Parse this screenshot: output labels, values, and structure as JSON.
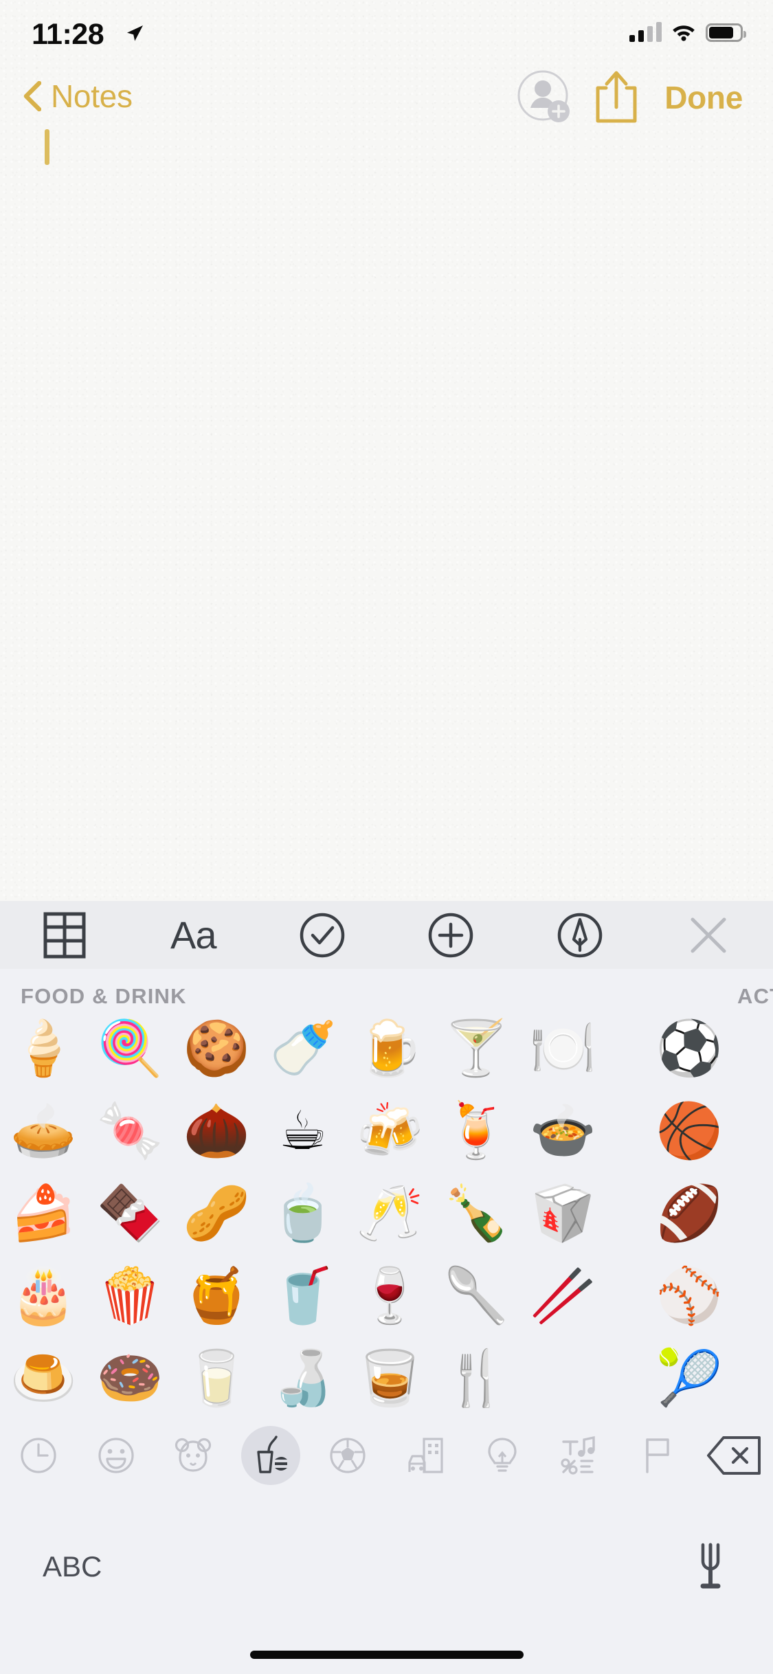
{
  "status_bar": {
    "time": "11:28",
    "location_icon": "location-arrow-icon",
    "cellular_icon": "cellular-signal-icon",
    "wifi_icon": "wifi-icon",
    "battery_icon": "battery-icon",
    "signal_bars_filled": 2,
    "signal_bars_total": 4,
    "battery_level_pct": 72
  },
  "nav_bar": {
    "back_label": "Notes",
    "back_icon": "chevron-left-icon",
    "add_person_icon": "add-person-icon",
    "share_icon": "share-icon",
    "done_label": "Done",
    "accent_color": "#d8b14a",
    "disabled_color": "#c9c9cd"
  },
  "note": {
    "text": "",
    "caret_color": "#dcbc5e"
  },
  "format_toolbar": {
    "background": "#ebecef",
    "items": [
      {
        "name": "table-icon",
        "label": "Table"
      },
      {
        "name": "text-format-icon",
        "label": "Aa"
      },
      {
        "name": "checklist-icon",
        "label": "Checklist"
      },
      {
        "name": "add-attachment-icon",
        "label": "Add"
      },
      {
        "name": "markup-pen-icon",
        "label": "Markup"
      },
      {
        "name": "close-icon",
        "label": "Close"
      }
    ]
  },
  "keyboard": {
    "background": "#f0f1f5",
    "category_headers": {
      "current": "FOOD & DRINK",
      "next": "ACTIVITY"
    },
    "emoji_rows": [
      [
        "🍦",
        "🍭",
        "🍪",
        "🍼",
        "🍺",
        "🍸",
        "🍽️",
        "⚽"
      ],
      [
        "🥧",
        "🍬",
        "🌰",
        "☕",
        "🍻",
        "🍹",
        "🍲",
        "🏀"
      ],
      [
        "🍰",
        "🍫",
        "🥜",
        "🍵",
        "🥂",
        "🍾",
        "🥡",
        "🏈"
      ],
      [
        "🎂",
        "🍿",
        "🍯",
        "🥤",
        "🍷",
        "🥄",
        "🥢",
        "⚾"
      ],
      [
        "🍮",
        "🍩",
        "🥛",
        "🍶",
        "🥃",
        "🍴",
        "",
        "🎾"
      ]
    ],
    "category_bar": [
      {
        "name": "recent-clock-icon",
        "label": "Recent",
        "selected": false
      },
      {
        "name": "smileys-icon",
        "label": "Smileys & People",
        "selected": false
      },
      {
        "name": "animals-icon",
        "label": "Animals & Nature",
        "selected": false
      },
      {
        "name": "food-drink-icon",
        "label": "Food & Drink",
        "selected": true
      },
      {
        "name": "activity-icon",
        "label": "Activity",
        "selected": false
      },
      {
        "name": "travel-places-icon",
        "label": "Travel & Places",
        "selected": false
      },
      {
        "name": "objects-icon",
        "label": "Objects",
        "selected": false
      },
      {
        "name": "symbols-icon",
        "label": "Symbols",
        "selected": false
      },
      {
        "name": "flags-icon",
        "label": "Flags",
        "selected": false
      },
      {
        "name": "delete-backspace-icon",
        "label": "Delete",
        "selected": false
      }
    ],
    "abc_label": "ABC",
    "mic_icon": "microphone-icon"
  }
}
